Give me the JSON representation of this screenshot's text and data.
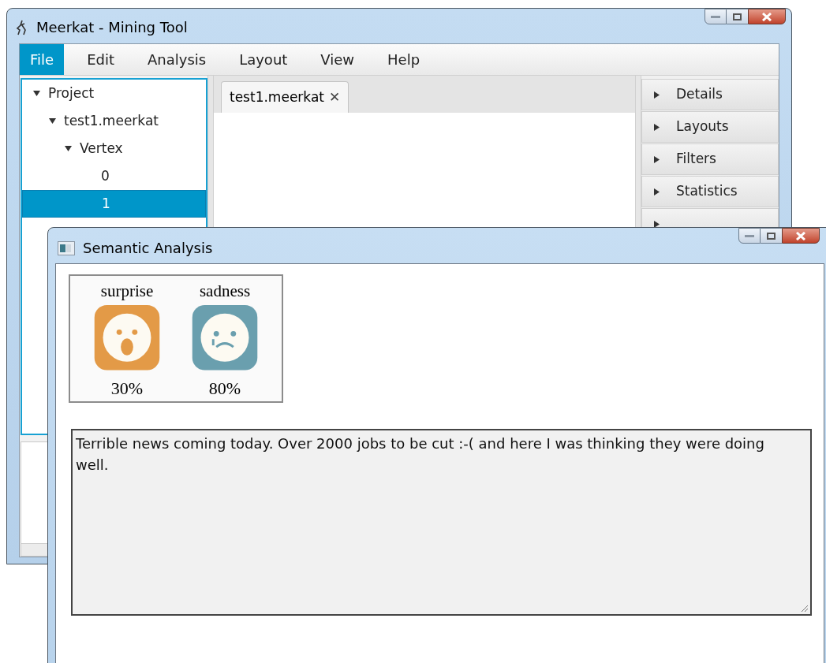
{
  "main_window": {
    "title": "Meerkat - Mining Tool",
    "menu": [
      {
        "label": "File",
        "selected": true
      },
      {
        "label": "Edit",
        "selected": false
      },
      {
        "label": "Analysis",
        "selected": false
      },
      {
        "label": "Layout",
        "selected": false
      },
      {
        "label": "View",
        "selected": false
      },
      {
        "label": "Help",
        "selected": false
      }
    ],
    "tree": [
      {
        "label": "Project",
        "expanded": true,
        "selected": false,
        "children": [
          {
            "label": "test1.meerkat",
            "expanded": true,
            "selected": false,
            "children": [
              {
                "label": "Vertex",
                "expanded": true,
                "selected": false,
                "children": [
                  {
                    "label": "0",
                    "selected": false
                  },
                  {
                    "label": "1",
                    "selected": true
                  }
                ]
              }
            ]
          }
        ]
      }
    ],
    "tabs": [
      {
        "label": "test1.meerkat",
        "selected": true,
        "close": "✕"
      }
    ],
    "panels": [
      {
        "label": "Details",
        "expanded": false
      },
      {
        "label": "Layouts",
        "expanded": false
      },
      {
        "label": "Filters",
        "expanded": false
      },
      {
        "label": "Statistics",
        "expanded": false
      },
      {
        "expanded": false
      }
    ]
  },
  "dialog": {
    "title": "Semantic Analysis",
    "emotions": [
      {
        "label": "surprise",
        "kind": "surprise",
        "color": "#e39a47",
        "value": "30%"
      },
      {
        "label": "sadness",
        "kind": "sad",
        "color": "#6a9fae",
        "value": "80%"
      }
    ],
    "text": "Terrible news coming today. Over 2000 jobs to be cut :-( and here I was thinking they were doing well."
  }
}
